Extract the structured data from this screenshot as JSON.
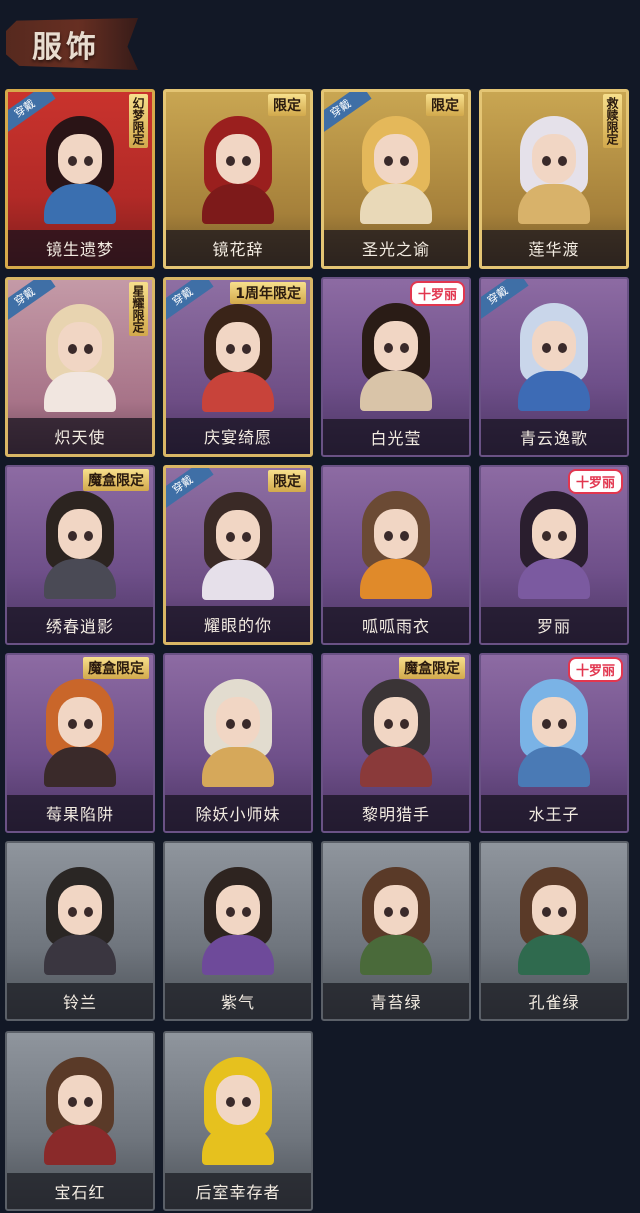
{
  "header": {
    "title": "服饰"
  },
  "colors": {
    "background": "#121826",
    "wear_ribbon": "#3f6fa6",
    "name_text": "#f3ece2"
  },
  "cards": [
    {
      "name": "镜生遗梦",
      "frame": "red",
      "worn": true,
      "tag": "幻梦限定",
      "tag_style": "vertical",
      "hair": "#2a1416",
      "body": "#3a6fb0"
    },
    {
      "name": "镜花辞",
      "frame": "gold",
      "worn": false,
      "tag": "限定",
      "tag_style": "",
      "hair": "#9a1f1e",
      "body": "#7d1a1a"
    },
    {
      "name": "圣光之谕",
      "frame": "gold",
      "worn": true,
      "tag": "限定",
      "tag_style": "",
      "hair": "#e4b85a",
      "body": "#e9d9b8"
    },
    {
      "name": "莲华渡",
      "frame": "gold",
      "worn": false,
      "tag": "救赎限定",
      "tag_style": "vertical",
      "hair": "#e5e1ea",
      "body": "#d8b26a"
    },
    {
      "name": "炽天使",
      "frame": "rose",
      "worn": true,
      "tag": "星耀限定",
      "tag_style": "vertical",
      "hair": "#e8d4b0",
      "body": "#f1e6e0"
    },
    {
      "name": "庆宴绮愿",
      "frame": "goldpurple",
      "worn": true,
      "tag": "1周年限定",
      "tag_style": "",
      "hair": "#3a2418",
      "body": "#c8433a"
    },
    {
      "name": "白光莹",
      "frame": "purple",
      "worn": false,
      "tag": "十罗丽",
      "tag_style": "pink",
      "hair": "#2a1c16",
      "body": "#d9c4a8"
    },
    {
      "name": "青云逸歌",
      "frame": "purple",
      "worn": true,
      "tag": "",
      "tag_style": "",
      "hair": "#c9d6ea",
      "body": "#3d6bb5"
    },
    {
      "name": "绣春逍影",
      "frame": "purple",
      "worn": false,
      "tag": "魔盒限定",
      "tag_style": "",
      "hair": "#2c2420",
      "body": "#4a4a55"
    },
    {
      "name": "耀眼的你",
      "frame": "goldpurple",
      "worn": true,
      "tag": "限定",
      "tag_style": "",
      "hair": "#3a2a26",
      "body": "#e6e0ea"
    },
    {
      "name": "呱呱雨衣",
      "frame": "purple",
      "worn": false,
      "tag": "",
      "tag_style": "",
      "hair": "#6b4a34",
      "body": "#e08a2a"
    },
    {
      "name": "罗丽",
      "frame": "purple",
      "worn": false,
      "tag": "十罗丽",
      "tag_style": "pink",
      "hair": "#2a1e2e",
      "body": "#7b5aa0"
    },
    {
      "name": "莓果陷阱",
      "frame": "purple",
      "worn": false,
      "tag": "魔盒限定",
      "tag_style": "",
      "hair": "#c9662a",
      "body": "#3a2a2a"
    },
    {
      "name": "除妖小师妹",
      "frame": "purple",
      "worn": false,
      "tag": "",
      "tag_style": "",
      "hair": "#e2dccf",
      "body": "#d6a85a"
    },
    {
      "name": "黎明猎手",
      "frame": "purple",
      "worn": false,
      "tag": "魔盒限定",
      "tag_style": "",
      "hair": "#3a3436",
      "body": "#8a3a3a"
    },
    {
      "name": "水王子",
      "frame": "purple",
      "worn": false,
      "tag": "十罗丽",
      "tag_style": "pink",
      "hair": "#7ab3e6",
      "body": "#4a7ab5"
    },
    {
      "name": "铃兰",
      "frame": "grey",
      "worn": false,
      "tag": "",
      "tag_style": "",
      "hair": "#2a2624",
      "body": "#3a3640"
    },
    {
      "name": "紫气",
      "frame": "grey",
      "worn": false,
      "tag": "",
      "tag_style": "",
      "hair": "#2e2420",
      "body": "#6e4a9a"
    },
    {
      "name": "青苔绿",
      "frame": "grey",
      "worn": false,
      "tag": "",
      "tag_style": "",
      "hair": "#5a3a28",
      "body": "#4a6a3a"
    },
    {
      "name": "孔雀绿",
      "frame": "grey",
      "worn": false,
      "tag": "",
      "tag_style": "",
      "hair": "#5a3a28",
      "body": "#2f6a4e"
    },
    {
      "name": "宝石红",
      "frame": "grey",
      "worn": false,
      "tag": "",
      "tag_style": "",
      "hair": "#5a3a28",
      "body": "#8a2a2a"
    },
    {
      "name": "后室幸存者",
      "frame": "grey",
      "worn": false,
      "tag": "",
      "tag_style": "",
      "hair": "#e6c11e",
      "body": "#e6c11e"
    }
  ],
  "labels": {
    "worn": "穿戴"
  }
}
